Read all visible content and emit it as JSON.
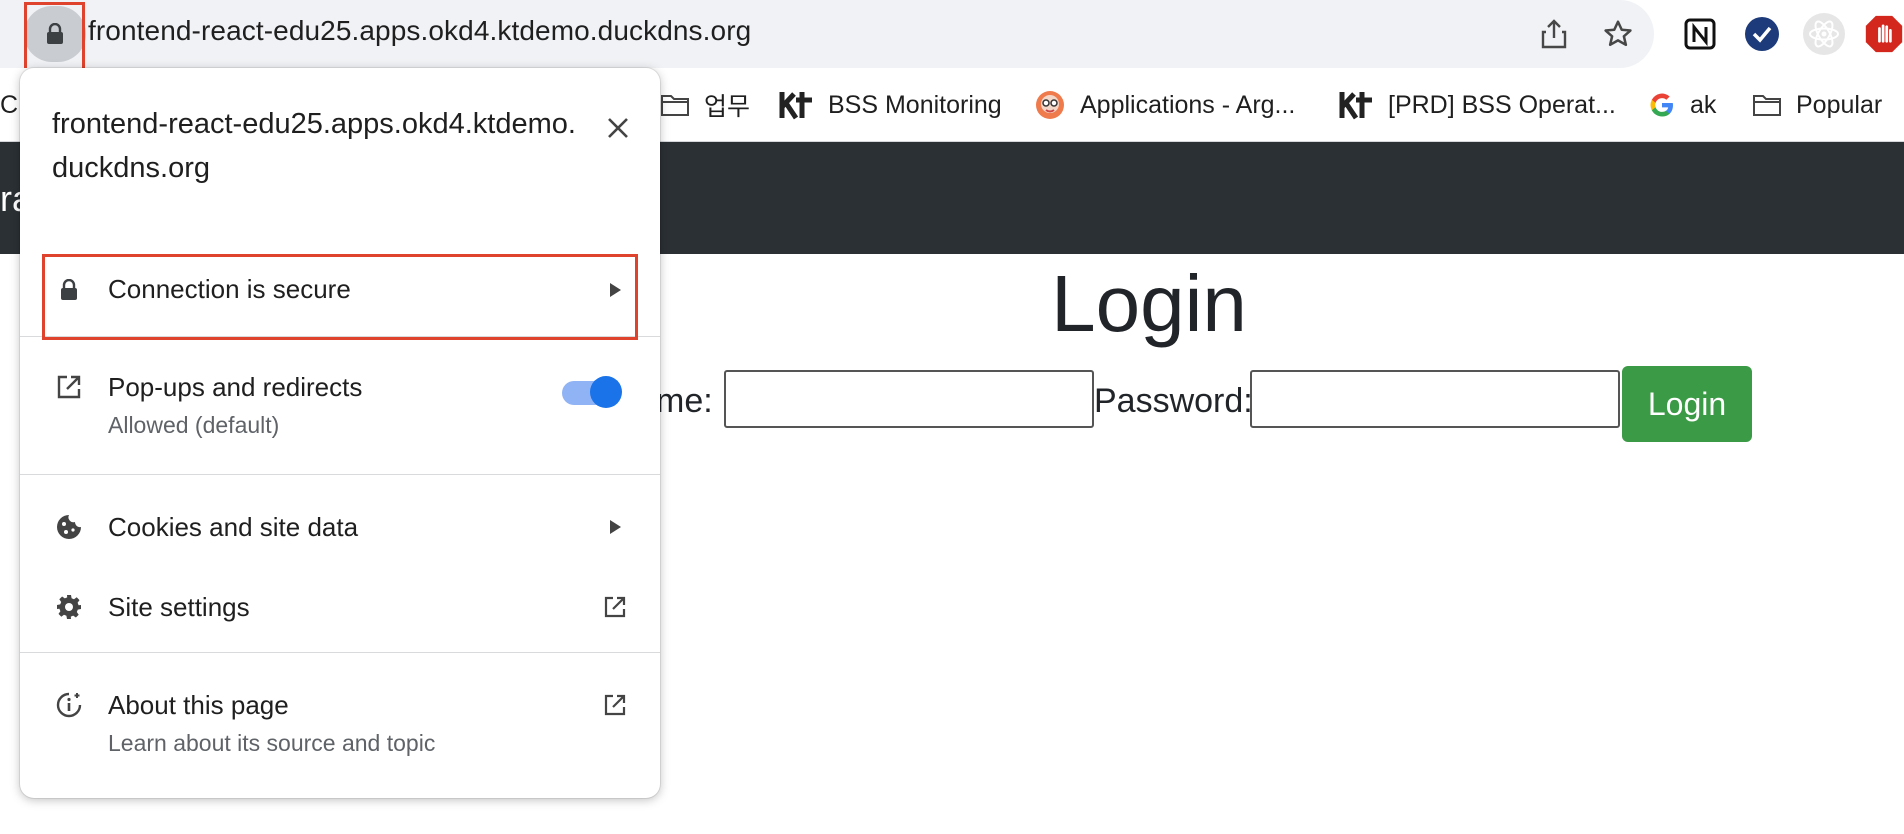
{
  "browser": {
    "url": "frontend-react-edu25.apps.okd4.ktdemo.duckdns.org"
  },
  "bookmarks": [
    {
      "label": "업무",
      "icon": "folder-icon"
    },
    {
      "label": "BSS Monitoring",
      "icon": "kt-logo-icon"
    },
    {
      "label": "Applications - Arg...",
      "icon": "argo-icon"
    },
    {
      "label": "[PRD] BSS Operat...",
      "icon": "kt-logo-icon"
    },
    {
      "label": "ak",
      "icon": "google-icon"
    },
    {
      "label": "Popular",
      "icon": "folder-icon"
    }
  ],
  "bookmarks_partial_left": "C..",
  "page": {
    "navbar_partial": "ra",
    "title": "Login",
    "username_label_partial": "me:",
    "password_label": "Password:",
    "login_button": "Login"
  },
  "popup": {
    "site": "frontend-react-edu25.apps.okd4.ktdemo.duckdns.org",
    "connection": "Connection is secure",
    "popups_title": "Pop-ups and redirects",
    "popups_status": "Allowed (default)",
    "popups_toggle_on": true,
    "cookies": "Cookies and site data",
    "site_settings": "Site settings",
    "about_title": "About this page",
    "about_sub": "Learn about its source and topic"
  },
  "colors": {
    "highlight": "#e0432d",
    "toggle_on": "#1a73e8",
    "navbar": "#2b3035",
    "login_button": "#3b9a45"
  }
}
